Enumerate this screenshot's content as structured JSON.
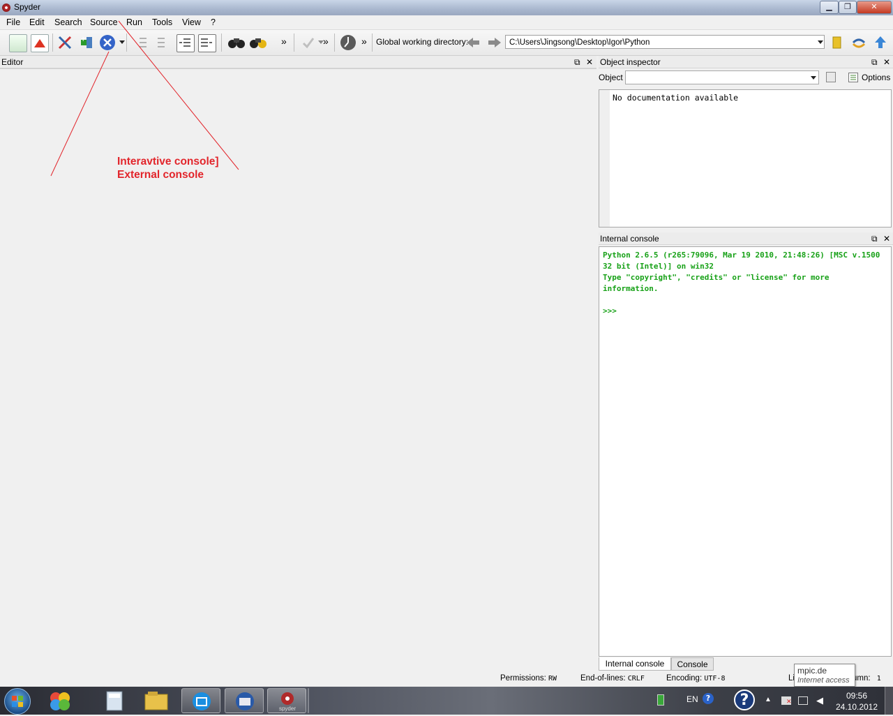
{
  "window": {
    "title": "Spyder"
  },
  "menu": [
    "File",
    "Edit",
    "Search",
    "Source",
    "Run",
    "Tools",
    "View",
    "?"
  ],
  "toolbar": {
    "more_glyph": "»",
    "cwd_label": "Global working directory:",
    "cwd_value": "C:\\Users\\Jingsong\\Desktop\\Igor\\Python",
    "icons": [
      "new-file-icon",
      "open-icon",
      "preferences-icon",
      "pythonpath-icon",
      "run-icon",
      "indent-icon",
      "unindent-icon",
      "comment-icon",
      "uncomment-icon",
      "find-icon",
      "replace-icon",
      "check-icon",
      "profiler-icon",
      "back-icon",
      "forward-icon",
      "browse-folder-icon",
      "pythonpath-sync-icon",
      "parent-dir-icon"
    ]
  },
  "editor": {
    "title": "Editor"
  },
  "object_inspector": {
    "title": "Object inspector",
    "object_label": "Object",
    "options_label": "Options",
    "doc_text": "No documentation available"
  },
  "internal_console": {
    "title": "Internal console",
    "text": "Python 2.6.5 (r265:79096, Mar 19 2010, 21:48:26) [MSC v.1500 32 bit (Intel)] on win32\nType \"copyright\", \"credits\" or \"license\" for more information.\n\n>>>",
    "tabs": [
      {
        "label": "Internal console",
        "active": true
      },
      {
        "label": "Console",
        "active": false
      }
    ]
  },
  "status_bar": {
    "permissions_label": "Permissions:",
    "permissions_value": "RW",
    "eol_label": "End-of-lines:",
    "eol_value": "CRLF",
    "encoding_label": "Encoding:",
    "encoding_value": "UTF-8",
    "line_label_partial": "Li",
    "column_label_partial": "umn:",
    "column_value": "1"
  },
  "tooltip": {
    "title": "mpic.de",
    "subtitle": "Internet access"
  },
  "annotation": {
    "line1": "Interavtive console]",
    "line2": "External console",
    "color": "#e2252b"
  },
  "taskbar": {
    "apps": [
      "start-orb",
      "picasa",
      "calculator",
      "file-explorer",
      "maxthon",
      "thunderbird",
      "spyder"
    ],
    "spyder_label": "spyder",
    "language": "EN",
    "time": "09:56",
    "date": "24.10.2012"
  },
  "colors": {
    "console_text": "#17a117",
    "annotation": "#e2252b"
  }
}
